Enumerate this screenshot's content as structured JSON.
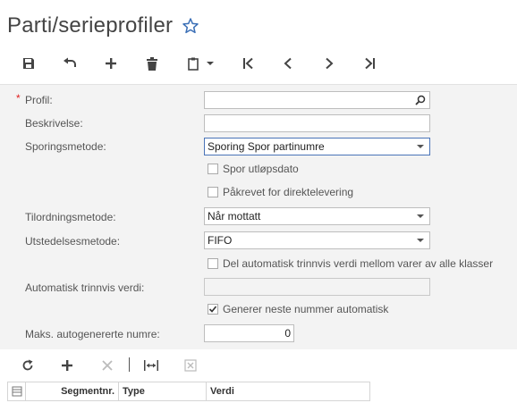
{
  "page": {
    "title": "Parti/serieprofiler"
  },
  "toolbar": {
    "buttons": [
      "save-icon",
      "undo-icon",
      "add-icon",
      "delete-icon",
      "clipboard-icon",
      "first-icon",
      "prev-icon",
      "next-icon",
      "last-icon"
    ]
  },
  "form": {
    "profil_label": "Profil:",
    "profil_value": "",
    "beskrivelse_label": "Beskrivelse:",
    "beskrivelse_value": "",
    "sporingsmetode_label": "Sporingsmetode:",
    "sporingsmetode_value": "Sporing Spor partinumre",
    "spor_utlopsdato_label": "Spor utløpsdato",
    "spor_utlopsdato_checked": false,
    "pakrevet_label": "Påkrevet for direktelevering",
    "pakrevet_checked": false,
    "tilordningsmetode_label": "Tilordningsmetode:",
    "tilordningsmetode_value": "Når mottatt",
    "utstedelsesmetode_label": "Utstedelsesmetode:",
    "utstedelsesmetode_value": "FIFO",
    "del_auto_label": "Del automatisk trinnvis verdi mellom varer av alle klasser",
    "del_auto_checked": false,
    "auto_trinnvis_label": "Automatisk trinnvis verdi:",
    "auto_trinnvis_value": "",
    "generer_label": "Generer neste nummer automatisk",
    "generer_checked": true,
    "maks_label": "Maks. autogenererte numre:",
    "maks_value": "0"
  },
  "grid": {
    "columns": [
      "Segmentnr.",
      "Type",
      "Verdi"
    ]
  },
  "colors": {
    "accent": "#4a74b8",
    "required": "#e02020",
    "form_bg": "#f3f3f3"
  }
}
